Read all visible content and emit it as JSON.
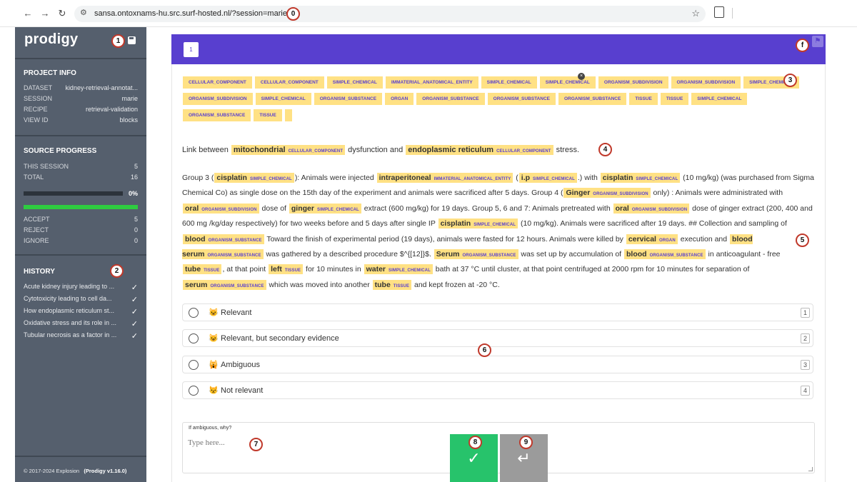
{
  "browser": {
    "url": "sansa.ontoxnams-hu.src.surf-hosted.nl/?session=marie",
    "back_icon": "←",
    "forward_icon": "→",
    "reload_icon": "↻",
    "site_settings_icon": "⚙",
    "star_icon": "☆"
  },
  "markers": [
    "0",
    "1",
    "2",
    "3",
    "4",
    "5",
    "6",
    "7",
    "8",
    "9",
    "f"
  ],
  "sidebar": {
    "logo": "prodigy",
    "project_info": {
      "heading": "PROJECT INFO",
      "rows": [
        {
          "key": "DATASET",
          "value": "kidney-retrieval-annotat..."
        },
        {
          "key": "SESSION",
          "value": "marie"
        },
        {
          "key": "RECIPE",
          "value": "retrieval-validation"
        },
        {
          "key": "VIEW ID",
          "value": "blocks"
        }
      ]
    },
    "source_progress": {
      "heading": "SOURCE PROGRESS",
      "rows": [
        {
          "key": "THIS SESSION",
          "value": "5"
        },
        {
          "key": "TOTAL",
          "value": "16"
        }
      ],
      "progress_pct_label": "0%",
      "progress_fraction": 0.0,
      "session_fraction": 1.0,
      "answer_rows": [
        {
          "key": "ACCEPT",
          "value": "5"
        },
        {
          "key": "REJECT",
          "value": "0"
        },
        {
          "key": "IGNORE",
          "value": "0"
        }
      ]
    },
    "history": {
      "heading": "HISTORY",
      "check": "✓",
      "items": [
        "Acute kidney injury leading to ...",
        "Cytotoxicity leading to cell da...",
        "How endoplasmic reticulum st...",
        "Oxidative stress and its role in ...",
        "Tubular necrosis as a factor in ..."
      ]
    },
    "footer_copy": "© 2017-2024 Explosion",
    "footer_version": "(Prodigy v1.16.0)"
  },
  "card": {
    "page_number": "1",
    "flag_icon": "⚑",
    "label_chips": [
      "CELLULAR_COMPONENT",
      "CELLULAR_COMPONENT",
      "SIMPLE_CHEMICAL",
      "IMMATERIAL_ANATOMICAL_ENTITY",
      "SIMPLE_CHEMICAL",
      "SIMPLE_CHEMICAL",
      "ORGANISM_SUBDIVISION",
      "ORGANISM_SUBDIVISION",
      "SIMPLE_CHEMICAL",
      "ORGANISM_SUBDIVISION",
      "SIMPLE_CHEMICAL",
      "ORGANISM_SUBSTANCE",
      "ORGAN",
      "ORGANISM_SUBSTANCE",
      "ORGANISM_SUBSTANCE",
      "ORGANISM_SUBSTANCE",
      "TISSUE",
      "TISSUE",
      "SIMPLE_CHEMICAL",
      "ORGANISM_SUBSTANCE",
      "TISSUE"
    ],
    "close_icon": "×",
    "title_segments": [
      {
        "t": "Link between "
      },
      {
        "t": "mitochondrial",
        "l": "CELLULAR_COMPONENT"
      },
      {
        "t": " dysfunction and "
      },
      {
        "t": "endoplasmic reticulum",
        "l": "CELLULAR_COMPONENT"
      },
      {
        "t": " stress."
      }
    ],
    "body_segments": [
      {
        "t": "Group 3 ("
      },
      {
        "t": "cisplatin",
        "l": "SIMPLE_CHEMICAL"
      },
      {
        "t": "): Animals were injected "
      },
      {
        "t": "intraperitoneal",
        "l": "IMMATERIAL_ANATOMICAL_ENTITY"
      },
      {
        "t": " ("
      },
      {
        "t": "i.p",
        "l": "SIMPLE_CHEMICAL"
      },
      {
        "t": ".) with "
      },
      {
        "t": "cisplatin",
        "l": "SIMPLE_CHEMICAL"
      },
      {
        "t": " (10 mg/kg) (was purchased from Sigma Chemical Co) as single dose on the 15th day of the experiment and animals were sacrificed after 5 days. Group 4 ("
      },
      {
        "t": "Ginger",
        "l": "ORGANISM_SUBDIVISION"
      },
      {
        "t": " only) : Animals were administrated with "
      },
      {
        "t": "oral",
        "l": "ORGANISM_SUBDIVISION"
      },
      {
        "t": " dose of "
      },
      {
        "t": "ginger",
        "l": "SIMPLE_CHEMICAL"
      },
      {
        "t": " extract (600 mg/kg) for 19 days. Group 5, 6 and 7: Animals pretreated with "
      },
      {
        "t": "oral",
        "l": "ORGANISM_SUBDIVISION"
      },
      {
        "t": " dose of ginger extract (200, 400 and 600 mg /kg/day respectively) for two weeks before and 5 days after single IP "
      },
      {
        "t": "cisplatin",
        "l": "SIMPLE_CHEMICAL"
      },
      {
        "t": " (10 mg/kg). Animals were sacrificed after 19 days. ## Collection and sampling of "
      },
      {
        "t": "blood",
        "l": "ORGANISM_SUBSTANCE"
      },
      {
        "t": " Toward the finish of experimental period (19 days), animals were fasted for 12 hours. Animals were killed by "
      },
      {
        "t": "cervical",
        "l": "ORGAN"
      },
      {
        "t": " execution and "
      },
      {
        "t": "blood serum",
        "l": "ORGANISM_SUBSTANCE"
      },
      {
        "t": " was gathered by a described procedure $^{[12]}$. "
      },
      {
        "t": "Serum",
        "l": "ORGANISM_SUBSTANCE"
      },
      {
        "t": " was set up by accumulation of "
      },
      {
        "t": "blood",
        "l": "ORGANISM_SUBSTANCE"
      },
      {
        "t": " in anticoagulant - free "
      },
      {
        "t": "tube",
        "l": "TISSUE"
      },
      {
        "t": ", at that point "
      },
      {
        "t": "left",
        "l": "TISSUE"
      },
      {
        "t": " for 10 minutes in "
      },
      {
        "t": "water",
        "l": "SIMPLE_CHEMICAL"
      },
      {
        "t": " bath at 37 °C until cluster, at that point centrifuged at 2000 rpm for 10 minutes for separation of "
      },
      {
        "t": "serum",
        "l": "ORGANISM_SUBSTANCE"
      },
      {
        "t": " which was moved into another "
      },
      {
        "t": "tube",
        "l": "TISSUE"
      },
      {
        "t": " and kept frozen at -20 °C."
      }
    ],
    "options": [
      {
        "emoji": "😺",
        "label": "Relevant",
        "key": "1"
      },
      {
        "emoji": "😺",
        "label": "Relevant, but secondary evidence",
        "key": "2"
      },
      {
        "emoji": "🙀",
        "label": "Ambiguous",
        "key": "3"
      },
      {
        "emoji": "😾",
        "label": "Not relevant",
        "key": "4"
      }
    ],
    "textarea": {
      "label": "If ambiguous, why?",
      "placeholder": "Type here..."
    },
    "accept_icon": "✓",
    "ignore_icon": "↵"
  }
}
